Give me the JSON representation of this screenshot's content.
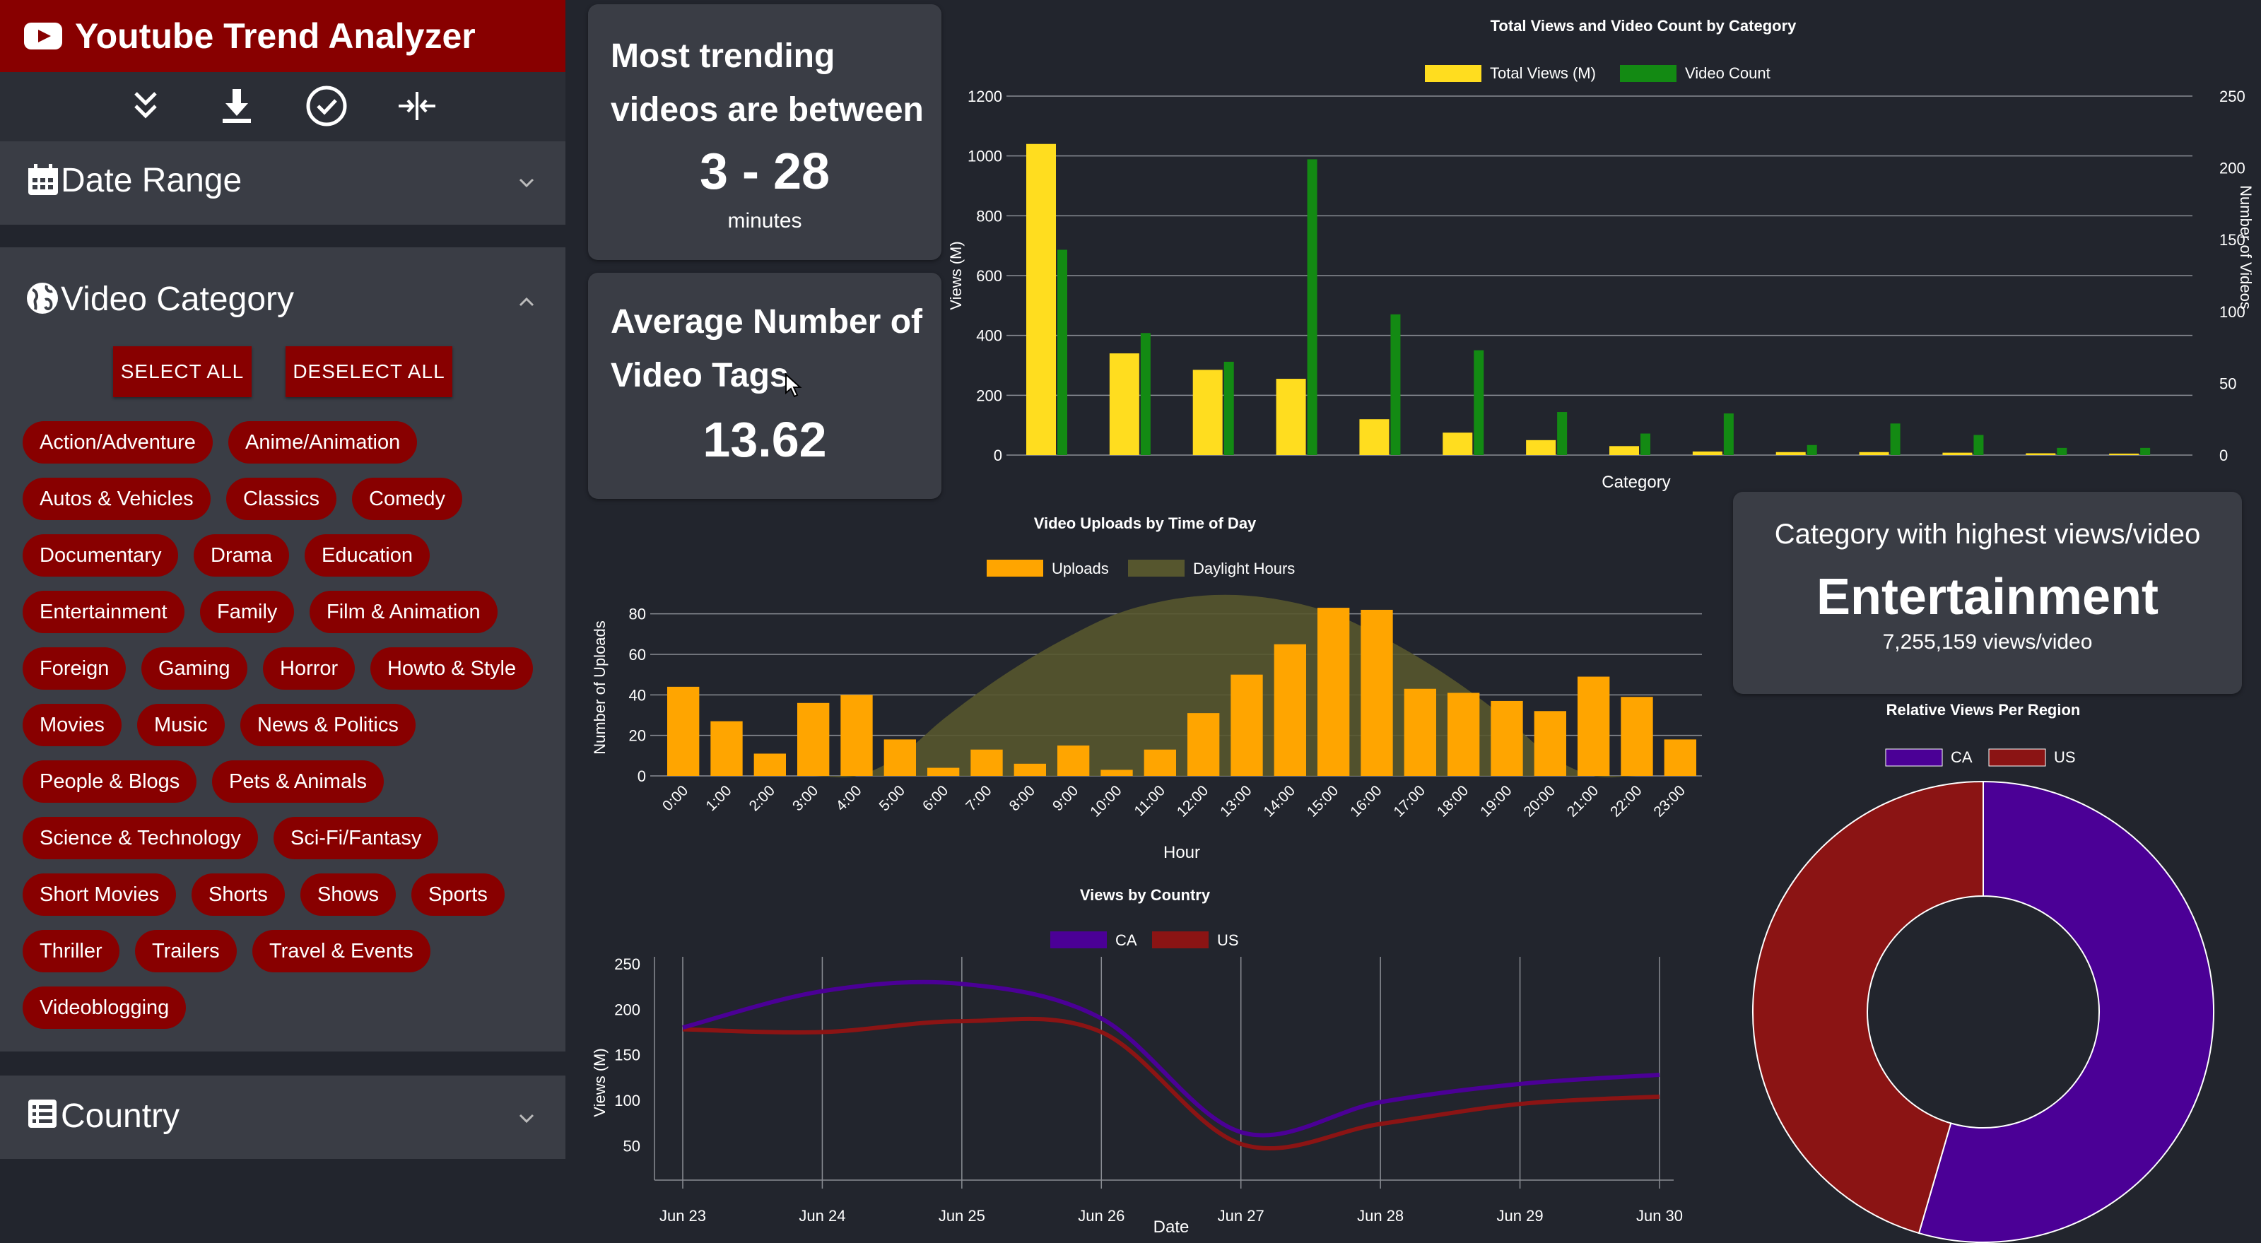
{
  "app": {
    "title": "Youtube Trend Analyzer"
  },
  "toolbar": [
    {
      "name": "expand-all-icon"
    },
    {
      "name": "download-icon"
    },
    {
      "name": "check-circle-icon"
    },
    {
      "name": "collapse-icon"
    }
  ],
  "sidebar": {
    "date_range": {
      "label": "Date Range"
    },
    "video_category": {
      "label": "Video Category",
      "select_all": "SELECT ALL",
      "deselect_all": "DESELECT ALL",
      "tags": [
        "Action/Adventure",
        "Anime/Animation",
        "Autos & Vehicles",
        "Classics",
        "Comedy",
        "Documentary",
        "Drama",
        "Education",
        "Entertainment",
        "Family",
        "Film & Animation",
        "Foreign",
        "Gaming",
        "Horror",
        "Howto & Style",
        "Movies",
        "Music",
        "News & Politics",
        "People & Blogs",
        "Pets & Animals",
        "Science & Technology",
        "Sci-Fi/Fantasy",
        "Short Movies",
        "Shorts",
        "Shows",
        "Sports",
        "Thriller",
        "Trailers",
        "Travel & Events",
        "Videoblogging"
      ]
    },
    "country": {
      "label": "Country"
    }
  },
  "cards": {
    "trending": {
      "line1": "Most trending",
      "line2": "videos are between",
      "value": "3 - 28",
      "unit": "minutes"
    },
    "tags": {
      "line1": "Average Number of",
      "line2": "Video Tags",
      "value": "13.62"
    },
    "highest": {
      "title": "Category with highest views/video",
      "value": "Entertainment",
      "sub": "7,255,159 views/video"
    }
  },
  "colors": {
    "accent": "#880000",
    "yellow": "#ffdd1f",
    "green": "#138a13",
    "orange": "#ffa500",
    "ca": "#4b0096",
    "us": "#8b1414"
  },
  "chart_data": [
    {
      "type": "bar",
      "title": "Total Views and Video Count by Category",
      "xlabel": "Category",
      "ylabel": "Views (M)",
      "y2label": "Number of Videos",
      "ylim": [
        0,
        1200
      ],
      "y2lim": [
        0,
        250
      ],
      "yticks": [
        0,
        200,
        400,
        600,
        800,
        1000,
        1200
      ],
      "y2ticks": [
        0,
        50,
        100,
        150,
        200,
        250
      ],
      "series": [
        {
          "name": "Total Views (M)",
          "values": [
            1040,
            340,
            285,
            255,
            120,
            75,
            50,
            30,
            12,
            10,
            10,
            8,
            6,
            5
          ]
        },
        {
          "name": "Video Count",
          "values": [
            143,
            85,
            65,
            206,
            98,
            73,
            30,
            15,
            29,
            7,
            22,
            14,
            5,
            5
          ]
        }
      ]
    },
    {
      "type": "bar",
      "title": "Video Uploads by Time of Day",
      "xlabel": "Hour",
      "ylabel": "Number of Uploads",
      "ylim": [
        0,
        90
      ],
      "yticks": [
        0,
        20,
        40,
        60,
        80
      ],
      "categories": [
        "0:00",
        "1:00",
        "2:00",
        "3:00",
        "4:00",
        "5:00",
        "6:00",
        "7:00",
        "8:00",
        "9:00",
        "10:00",
        "11:00",
        "12:00",
        "13:00",
        "14:00",
        "15:00",
        "16:00",
        "17:00",
        "18:00",
        "19:00",
        "20:00",
        "21:00",
        "22:00",
        "23:00"
      ],
      "series": [
        {
          "name": "Uploads",
          "values": [
            44,
            27,
            11,
            36,
            40,
            18,
            4,
            13,
            6,
            15,
            3,
            13,
            31,
            50,
            65,
            83,
            82,
            43,
            41,
            37,
            32,
            49,
            39,
            18
          ]
        },
        {
          "name": "Daylight Hours",
          "values": [
            0,
            0,
            0,
            0,
            0,
            10,
            28,
            44,
            58,
            70,
            80,
            86,
            89,
            89,
            86,
            80,
            70,
            58,
            44,
            28,
            10,
            0,
            0,
            0
          ]
        }
      ]
    },
    {
      "type": "line",
      "title": "Views by Country",
      "xlabel": "Date",
      "ylabel": "Views (M)",
      "ylim": [
        20,
        250
      ],
      "yticks": [
        50,
        100,
        150,
        200,
        250
      ],
      "categories": [
        "Jun 23",
        "Jun 24",
        "Jun 25",
        "Jun 26",
        "Jun 27",
        "Jun 28",
        "Jun 29",
        "Jun 30"
      ],
      "series": [
        {
          "name": "CA",
          "values": [
            180,
            220,
            228,
            190,
            65,
            98,
            118,
            128
          ]
        },
        {
          "name": "US",
          "values": [
            178,
            175,
            187,
            175,
            52,
            74,
            96,
            104
          ]
        }
      ]
    },
    {
      "type": "pie",
      "title": "Relative Views Per Region",
      "categories": [
        "CA",
        "US"
      ],
      "values": [
        54.5,
        45.5
      ]
    }
  ]
}
